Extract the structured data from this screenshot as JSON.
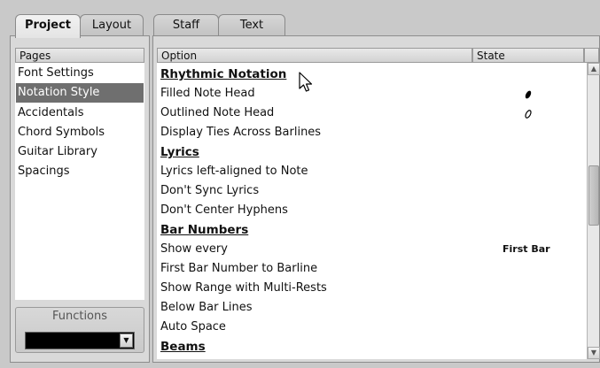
{
  "tabs": {
    "left": [
      {
        "label": "Project",
        "active": true
      },
      {
        "label": "Layout",
        "active": false
      }
    ],
    "right": [
      {
        "label": "Staff",
        "active": false
      },
      {
        "label": "Text",
        "active": false
      }
    ]
  },
  "pages": {
    "header": "Pages",
    "items": [
      {
        "label": "Font Settings",
        "selected": false
      },
      {
        "label": "Notation Style",
        "selected": true
      },
      {
        "label": "Accidentals",
        "selected": false
      },
      {
        "label": "Chord Symbols",
        "selected": false
      },
      {
        "label": "Guitar Library",
        "selected": false
      },
      {
        "label": "Spacings",
        "selected": false
      }
    ]
  },
  "options": {
    "header_option": "Option",
    "header_state": "State",
    "rows": [
      {
        "label": "Rhythmic Notation",
        "heading": true,
        "state": ""
      },
      {
        "label": "Filled Note Head",
        "heading": false,
        "state_icon": "filled-notehead-icon"
      },
      {
        "label": "Outlined Note Head",
        "heading": false,
        "state_icon": "outlined-notehead-icon"
      },
      {
        "label": "Display Ties Across Barlines",
        "heading": false,
        "state": ""
      },
      {
        "label": "Lyrics",
        "heading": true,
        "state": ""
      },
      {
        "label": "Lyrics left-aligned to Note",
        "heading": false,
        "state": ""
      },
      {
        "label": "Don't Sync Lyrics",
        "heading": false,
        "state": ""
      },
      {
        "label": "Don't Center Hyphens",
        "heading": false,
        "state": ""
      },
      {
        "label": "Bar Numbers",
        "heading": true,
        "state": ""
      },
      {
        "label": "Show every",
        "heading": false,
        "state": "First Bar"
      },
      {
        "label": "First Bar Number to Barline",
        "heading": false,
        "state": ""
      },
      {
        "label": "Show Range with Multi-Rests",
        "heading": false,
        "state": ""
      },
      {
        "label": "Below Bar Lines",
        "heading": false,
        "state": ""
      },
      {
        "label": "Auto Space",
        "heading": false,
        "state": ""
      },
      {
        "label": "Beams",
        "heading": true,
        "state": ""
      }
    ]
  },
  "functions": {
    "label": "Functions",
    "selected_value": ""
  },
  "colors": {
    "window_bg": "#c9c9c9",
    "selected_row_bg": "#6f6f6f",
    "list_bg": "#ffffff",
    "header_bg": "#dcdcdc"
  }
}
